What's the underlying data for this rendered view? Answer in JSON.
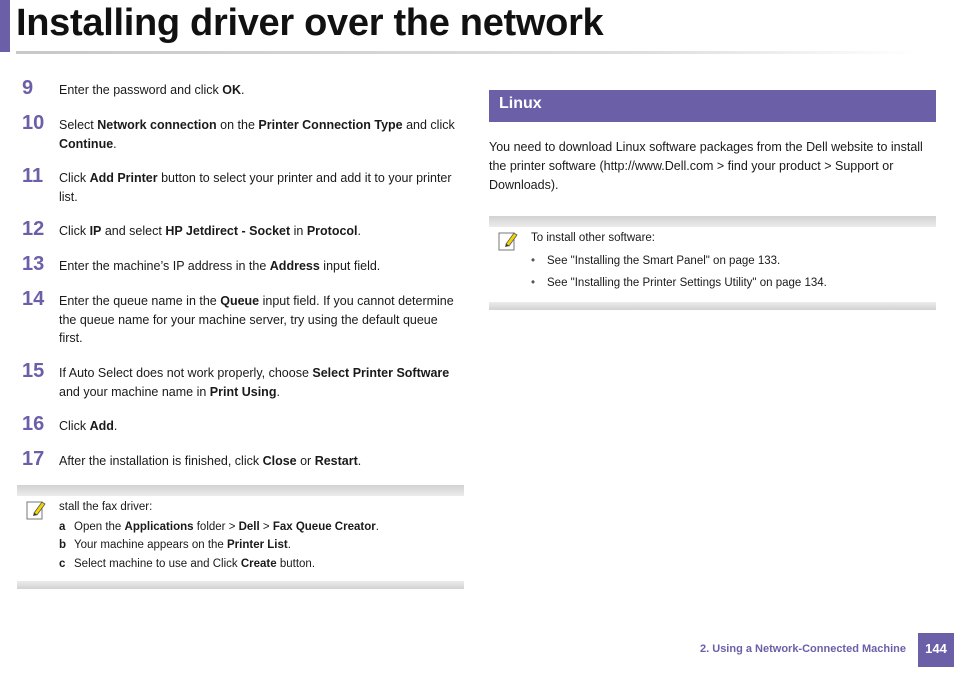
{
  "header": {
    "title": "Installing driver over the network"
  },
  "steps": [
    {
      "num": "9",
      "parts": [
        {
          "t": "Enter the password and click "
        },
        {
          "t": "OK",
          "b": true
        },
        {
          "t": "."
        }
      ]
    },
    {
      "num": "10",
      "parts": [
        {
          "t": "Select "
        },
        {
          "t": "Network connection",
          "b": true
        },
        {
          "t": " on the "
        },
        {
          "t": "Printer Connection Type",
          "b": true
        },
        {
          "t": " and click "
        },
        {
          "t": "Continue",
          "b": true
        },
        {
          "t": "."
        }
      ]
    },
    {
      "num": "11",
      "parts": [
        {
          "t": "Click "
        },
        {
          "t": "Add Printer",
          "b": true
        },
        {
          "t": " button to select your printer and add it to your printer list."
        }
      ]
    },
    {
      "num": "12",
      "parts": [
        {
          "t": "Click "
        },
        {
          "t": "IP",
          "b": true
        },
        {
          "t": " and select "
        },
        {
          "t": "HP Jetdirect - Socket",
          "b": true
        },
        {
          "t": " in "
        },
        {
          "t": "Protocol",
          "b": true
        },
        {
          "t": "."
        }
      ]
    },
    {
      "num": "13",
      "parts": [
        {
          "t": "Enter the machine’s IP address in the "
        },
        {
          "t": "Address",
          "b": true
        },
        {
          "t": " input field."
        }
      ]
    },
    {
      "num": "14",
      "parts": [
        {
          "t": "Enter the queue name in the "
        },
        {
          "t": "Queue",
          "b": true
        },
        {
          "t": " input field. If you cannot determine the queue name for your machine server, try using the default queue first."
        }
      ]
    },
    {
      "num": "15",
      "parts": [
        {
          "t": "If Auto Select does not work properly, choose "
        },
        {
          "t": "Select Printer Software",
          "b": true
        },
        {
          "t": " and your machine name in "
        },
        {
          "t": "Print Using",
          "b": true
        },
        {
          "t": "."
        }
      ]
    },
    {
      "num": "16",
      "parts": [
        {
          "t": "Click "
        },
        {
          "t": "Add",
          "b": true
        },
        {
          "t": "."
        }
      ]
    },
    {
      "num": "17",
      "parts": [
        {
          "t": "After the installation is finished, click "
        },
        {
          "t": "Close",
          "b": true
        },
        {
          "t": " or "
        },
        {
          "t": "Restart",
          "b": true
        },
        {
          "t": "."
        }
      ]
    }
  ],
  "fax_note": {
    "intro": "stall the fax driver:",
    "items": [
      {
        "letter": "a",
        "parts": [
          {
            "t": "Open the "
          },
          {
            "t": "Applications",
            "b": true
          },
          {
            "t": " folder > "
          },
          {
            "t": "Dell",
            "b": true
          },
          {
            "t": " > "
          },
          {
            "t": "Fax Queue Creator",
            "b": true
          },
          {
            "t": "."
          }
        ]
      },
      {
        "letter": "b",
        "parts": [
          {
            "t": "Your machine appears on the "
          },
          {
            "t": "Printer List",
            "b": true
          },
          {
            "t": "."
          }
        ]
      },
      {
        "letter": "c",
        "parts": [
          {
            "t": "Select machine to use and Click "
          },
          {
            "t": "Create",
            "b": true
          },
          {
            "t": " button."
          }
        ]
      }
    ]
  },
  "linux": {
    "heading": "Linux",
    "paragraph": "You need to download Linux software packages from the Dell website to install the printer software (http://www.Dell.com > find your product > Support or Downloads)."
  },
  "other_note": {
    "intro": "To install other software:",
    "bullet_char": "•",
    "bullets": [
      "See \"Installing the Smart Panel\" on page 133.",
      "See \"Installing the Printer Settings Utility\" on page 134."
    ]
  },
  "footer": {
    "chapter": "2.  Using a Network-Connected Machine",
    "page": "144"
  },
  "colors": {
    "accent": "#6b5fa8",
    "note_icon": "#f2d400"
  }
}
